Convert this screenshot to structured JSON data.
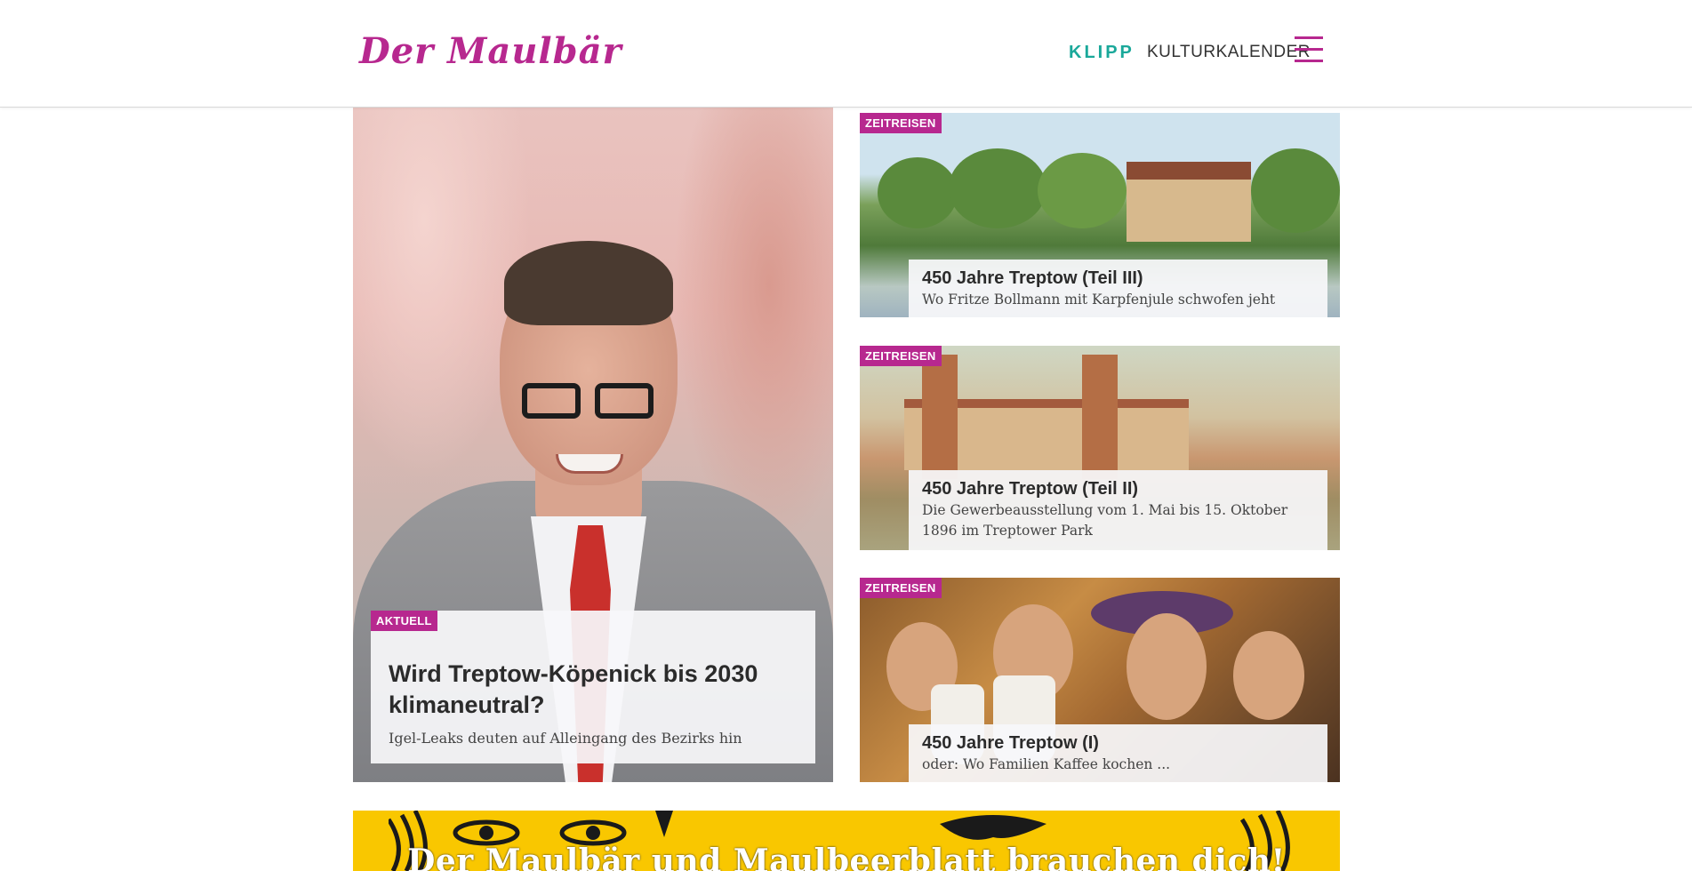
{
  "header": {
    "logo": "Der Maulbär",
    "nav": {
      "klipp": "KLIPP",
      "kulturkalender": "KULTURKALENDER"
    },
    "menu_icon": "hamburger-menu-icon"
  },
  "featured": {
    "tag": "AKTUELL",
    "title": "Wird Treptow-Köpenick bis 2030 klimaneutral?",
    "subtitle": "Igel-Leaks deuten auf Alleingang des Bezirks hin"
  },
  "articles": [
    {
      "tag": "ZEITREISEN",
      "title": "450 Jahre Treptow (Teil III)",
      "subtitle": "Wo Fritze Bollmann mit Karpfenjule schwofen jeht"
    },
    {
      "tag": "ZEITREISEN",
      "title": "450 Jahre Treptow (Teil II)",
      "subtitle": "Die Gewerbeausstellung vom 1. Mai bis 15. Oktober 1896 im Treptower Park"
    },
    {
      "tag": "ZEITREISEN",
      "title": "450 Jahre Treptow (I)",
      "subtitle": "oder: Wo Familien Kaffee kochen ..."
    }
  ],
  "banner": {
    "text": "Der Maulbär und Maulbeerblatt brauchen dich!"
  },
  "colors": {
    "brand": "#b7288f",
    "klipp": "#1aa89a",
    "banner": "#f9c700"
  }
}
